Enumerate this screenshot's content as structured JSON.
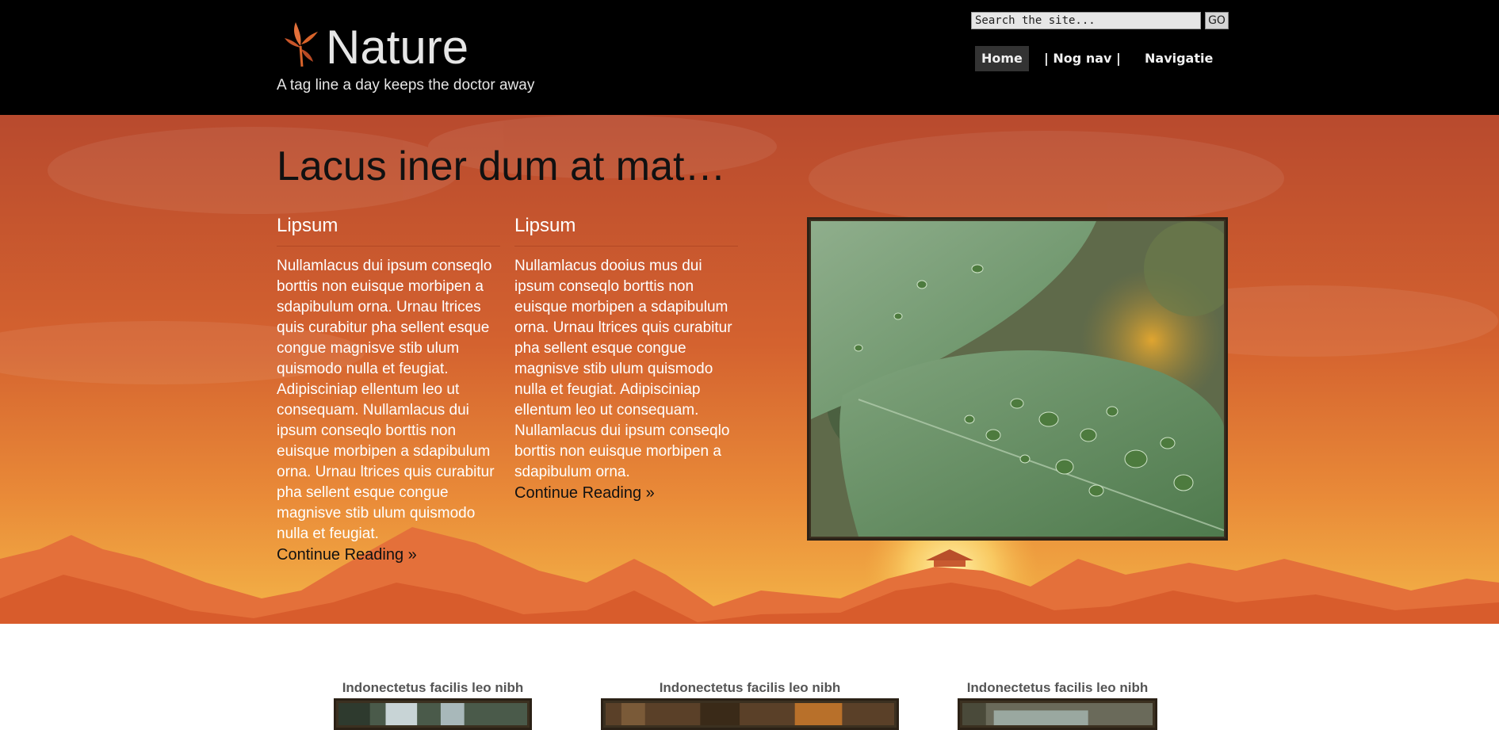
{
  "header": {
    "site_title": "Nature",
    "tagline": "A tag line a day keeps the doctor away",
    "logo_icon": "leaf-logo-icon",
    "search": {
      "placeholder": "Search the site...",
      "value": "",
      "button_label": "GO"
    },
    "nav": [
      {
        "label": "Home",
        "active": true
      },
      {
        "label": "| Nog nav |",
        "active": false
      },
      {
        "label": "Navigatie",
        "active": false
      }
    ]
  },
  "hero": {
    "heading": "Lacus iner dum at mat…",
    "columns": [
      {
        "title": "Lipsum",
        "text": "Nullamlacus dui ipsum conseqlo borttis non euisque morbipen a sdapibulum orna. Urnau ltrices quis curabitur pha sellent esque congue magnisve stib ulum quismodo nulla et feugiat. Adipisciniap ellentum leo ut consequam. Nullamlacus dui ipsum conseqlo borttis non euisque morbipen a sdapibulum orna. Urnau ltrices quis curabitur pha sellent esque congue magnisve stib ulum quismodo nulla et feugiat.",
        "read_more": "Continue Reading »"
      },
      {
        "title": "Lipsum",
        "text": "Nullamlacus dooius mus dui ipsum conseqlo borttis non euisque morbipen a sdapibulum orna. Urnau ltrices quis curabitur pha sellent esque congue magnisve stib ulum quismodo nulla et feugiat. Adipisciniap ellentum leo ut consequam. Nullamlacus dui ipsum conseqlo borttis non euisque morbipen a sdapibulum orna.",
        "read_more": "Continue Reading »"
      }
    ],
    "featured_image": "leaf-with-water-drops-photo"
  },
  "thumbnails": [
    {
      "title": "Indonectetus facilis leo nibh",
      "image": "waterfall-photo"
    },
    {
      "title": "Indonectetus facilis leo nibh",
      "image": "tree-bark-photo"
    },
    {
      "title": "Indonectetus facilis leo nibh",
      "image": "river-photo"
    }
  ],
  "colors": {
    "header_bg": "#000000",
    "hero_sky_top": "#b84a2e",
    "hero_sky_bottom": "#f2a23c",
    "nav_active_bg": "#333333",
    "frame": "#2b2116"
  }
}
